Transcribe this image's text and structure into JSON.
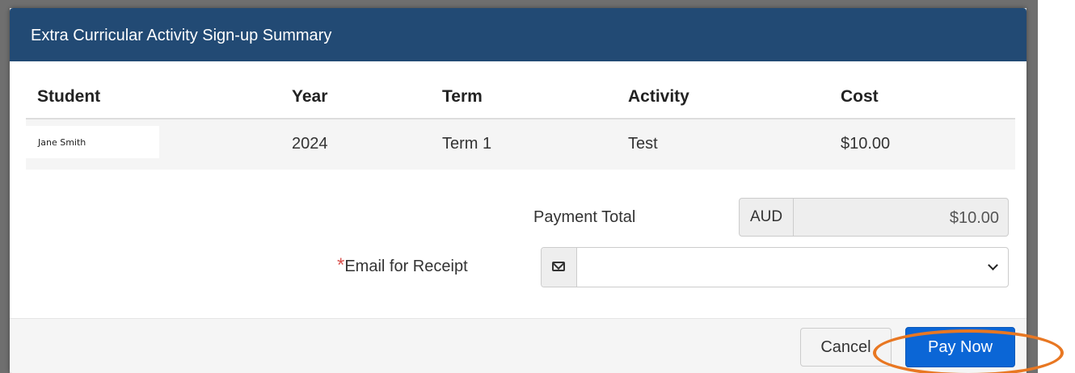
{
  "modal": {
    "title": "Extra Curricular Activity Sign-up Summary"
  },
  "table": {
    "headers": {
      "student": "Student",
      "year": "Year",
      "term": "Term",
      "activity": "Activity",
      "cost": "Cost"
    },
    "rows": [
      {
        "student": "Jane Smith",
        "year": "2024",
        "term": "Term 1",
        "activity": "Test",
        "cost": "$10.00"
      }
    ]
  },
  "payment": {
    "label": "Payment Total",
    "currency": "AUD",
    "amount": "$10.00"
  },
  "email": {
    "required_marker": "*",
    "label": "Email for Receipt",
    "icon": "envelope-icon",
    "selected_value": ""
  },
  "footer": {
    "cancel_label": "Cancel",
    "pay_label": "Pay Now"
  },
  "colors": {
    "header_bg": "#224a74",
    "pay_button": "#0b66d6",
    "highlight_ring": "#e87722",
    "required": "#d9534f"
  }
}
